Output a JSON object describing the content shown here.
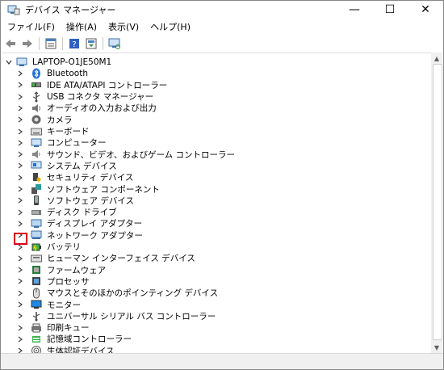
{
  "window": {
    "title": "デバイス マネージャー"
  },
  "caption": {
    "minimize": "—",
    "maximize": "☐",
    "close": "✕"
  },
  "menu": [
    "ファイル(F)",
    "操作(A)",
    "表示(V)",
    "ヘルプ(H)"
  ],
  "toolbar": [
    "back-icon",
    "forward-icon",
    "properties-icon",
    "show-hide-icon",
    "help-icon",
    "action-icon",
    "scan-hardware-icon"
  ],
  "tree": {
    "root": "LAPTOP-O1JE50M1",
    "items": [
      {
        "label": "Bluetooth",
        "icon": "bluetooth-icon"
      },
      {
        "label": "IDE ATA/ATAPI コントローラー",
        "icon": "ide-icon"
      },
      {
        "label": "USB コネクタ マネージャー",
        "icon": "usb-icon"
      },
      {
        "label": "オーディオの入力および出力",
        "icon": "audio-icon"
      },
      {
        "label": "カメラ",
        "icon": "camera-icon"
      },
      {
        "label": "キーボード",
        "icon": "keyboard-icon"
      },
      {
        "label": "コンピューター",
        "icon": "computer-icon"
      },
      {
        "label": "サウンド、ビデオ、およびゲーム コントローラー",
        "icon": "sound-icon"
      },
      {
        "label": "システム デバイス",
        "icon": "system-icon"
      },
      {
        "label": "セキュリティ デバイス",
        "icon": "security-icon"
      },
      {
        "label": "ソフトウェア コンポーネント",
        "icon": "software-component-icon"
      },
      {
        "label": "ソフトウェア デバイス",
        "icon": "software-device-icon"
      },
      {
        "label": "ディスク ドライブ",
        "icon": "disk-icon"
      },
      {
        "label": "ディスプレイ アダプター",
        "icon": "display-icon"
      },
      {
        "label": "ネットワーク アダプター",
        "icon": "network-icon"
      },
      {
        "label": "バッテリ",
        "icon": "battery-icon"
      },
      {
        "label": "ヒューマン インターフェイス デバイス",
        "icon": "hid-icon"
      },
      {
        "label": "ファームウェア",
        "icon": "firmware-icon"
      },
      {
        "label": "プロセッサ",
        "icon": "processor-icon"
      },
      {
        "label": "マウスとそのほかのポインティング デバイス",
        "icon": "mouse-icon"
      },
      {
        "label": "モニター",
        "icon": "monitor-icon"
      },
      {
        "label": "ユニバーサル シリアル バス コントローラー",
        "icon": "usb-controller-icon"
      },
      {
        "label": "印刷キュー",
        "icon": "printer-icon"
      },
      {
        "label": "記憶域コントローラー",
        "icon": "storage-icon"
      },
      {
        "label": "生体認証デバイス",
        "icon": "biometric-icon"
      }
    ]
  },
  "colors": {
    "highlight": "#e0001a",
    "accent": "#1e6fd9"
  }
}
